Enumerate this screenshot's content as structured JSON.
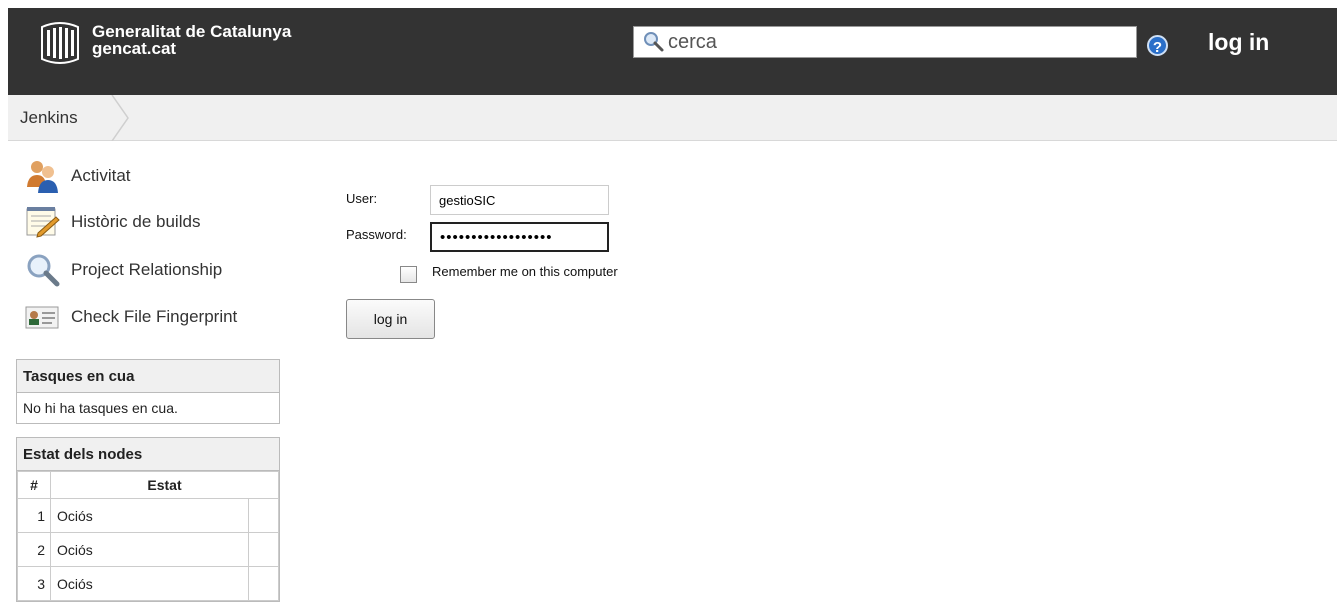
{
  "header": {
    "org_name": "Generalitat de Catalunya",
    "org_domain": "gencat.cat",
    "search_placeholder": "cerca",
    "help_label": "?",
    "login_label": "log in"
  },
  "breadcrumb": {
    "items": [
      "Jenkins"
    ]
  },
  "sidebar": {
    "tasks": [
      {
        "label": "Activitat",
        "icon": "people-icon"
      },
      {
        "label": "Històric de builds",
        "icon": "notepad-icon"
      },
      {
        "label": "Project Relationship",
        "icon": "magnifier-icon"
      },
      {
        "label": "Check File Fingerprint",
        "icon": "fingerprint-card-icon"
      }
    ],
    "queue": {
      "title": "Tasques en cua",
      "empty_text": "No hi ha tasques en cua."
    },
    "executors": {
      "title": "Estat dels nodes",
      "col_num": "#",
      "col_status": "Estat",
      "rows": [
        {
          "num": "1",
          "status": "Ociós"
        },
        {
          "num": "2",
          "status": "Ociós"
        },
        {
          "num": "3",
          "status": "Ociós"
        }
      ]
    }
  },
  "login_form": {
    "user_label": "User:",
    "user_value": "gestioSIC",
    "password_label": "Password:",
    "password_value": "••••••••••••••••••",
    "remember_label": "Remember me on this computer",
    "remember_checked": false,
    "submit_label": "log in"
  },
  "colors": {
    "header_bg": "#333333",
    "breadcrumb_bg": "#f0f0f0",
    "help_blue": "#2a6fc9"
  }
}
